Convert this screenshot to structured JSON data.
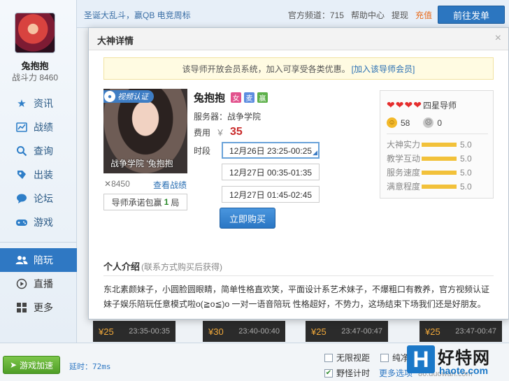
{
  "sidebar": {
    "username": "兔抱抱",
    "power_label": "战斗力",
    "power_value": "8460",
    "items": [
      {
        "label": "资讯",
        "icon": "star-icon"
      },
      {
        "label": "战绩",
        "icon": "chart-icon"
      },
      {
        "label": "查询",
        "icon": "search-icon"
      },
      {
        "label": "出装",
        "icon": "equipment-icon"
      },
      {
        "label": "论坛",
        "icon": "chat-bubble-icon"
      },
      {
        "label": "游戏",
        "icon": "gamepad-icon"
      },
      {
        "label": "陪玩",
        "icon": "people-icon"
      },
      {
        "label": "直播",
        "icon": "play-icon"
      },
      {
        "label": "更多",
        "icon": "grid-icon"
      }
    ],
    "active": "陪玩"
  },
  "topbar": {
    "news": "圣诞大乱斗，赢QB 电竞周标",
    "links": [
      "官方频道：715",
      "帮助中心",
      "提现",
      "充值"
    ],
    "order_button": "前往发单"
  },
  "background_cards": [
    {
      "price": "¥25",
      "time": "23:35-00:35"
    },
    {
      "price": "¥30",
      "time": "23:40-00:40"
    },
    {
      "price": "¥25",
      "time": "23:47-00:47"
    },
    {
      "price": "¥25",
      "time": "23:47-00:47"
    }
  ],
  "bottombar": {
    "speed_button": "游戏加速",
    "latency_label": "延时：",
    "latency_value": "72ms",
    "options": [
      {
        "label": "无限视距",
        "checked": false
      },
      {
        "label": "纯净",
        "checked": false
      },
      {
        "label": "野怪计时",
        "checked": true
      }
    ],
    "more": "更多选项"
  },
  "watermark": {
    "logo": "H",
    "title": "好特网",
    "url": "haote.com",
    "faint": "86.duowan.com"
  },
  "modal": {
    "title": "大神详情",
    "close": "×",
    "notice": "该导师开放会员系统，加入可享受各类优惠。",
    "notice_link": "[加入该导师会员]",
    "photo_badge": "视频认证",
    "photo_caption": "战争学院  '兔抱抱",
    "views": "8450",
    "record_link": "查看战绩",
    "promise_label": "导师承诺包赢",
    "promise_count": "1",
    "promise_unit": "局",
    "name": "兔抱抱",
    "tags": [
      "女",
      "麦",
      "赢"
    ],
    "server_label": "服务器：",
    "server": "战争学院",
    "fee_label": "费用",
    "currency": "￥",
    "price": "35",
    "slot_label": "时段",
    "slots": [
      "12月26日 23:25-00:25",
      "12月27日 00:35-01:35",
      "12月27日 01:45-02:45"
    ],
    "selected_slot": 0,
    "buy_button": "立即购买",
    "rating": {
      "hearts": 4,
      "rank": "四星导师",
      "good": "58",
      "bad": "0",
      "metrics": [
        {
          "label": "大神实力",
          "value": "5.0"
        },
        {
          "label": "教学互动",
          "value": "5.0"
        },
        {
          "label": "服务速度",
          "value": "5.0"
        },
        {
          "label": "满意程度",
          "value": "5.0"
        }
      ]
    },
    "intro_title": "个人介绍",
    "intro_hint": "(联系方式购买后获得)",
    "intro_text": "东北素颜妹子，小圆脸圆眼睛，简单性格直欢笑，平面设计系艺术妹子，不爆粗口有教养，官方视频认证妹子娱乐陪玩任意模式啦o(≧o≦)o 一对一语音陪玩 性格超好，不势力，这场结束下场我们还是好朋友。"
  },
  "colors": {
    "accent": "#2f78c3",
    "price": "#c92a2a",
    "heart": "#e52d2d",
    "bar": "#f2c13a"
  }
}
